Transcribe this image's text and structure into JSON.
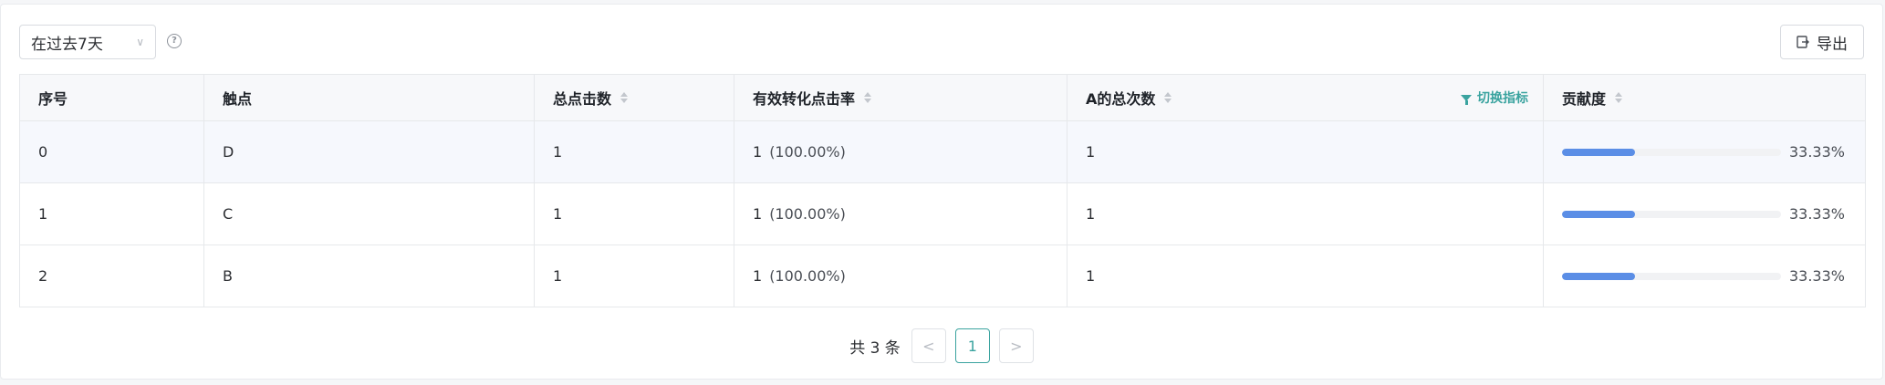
{
  "toolbar": {
    "date_range": "在过去7天",
    "export_label": "导出"
  },
  "table": {
    "headers": {
      "index": "序号",
      "touchpoint": "触点",
      "total_clicks": "总点击数",
      "effective_rate": "有效转化点击率",
      "a_total": "A的总次数",
      "switch_metric": "切换指标",
      "contribution": "贡献度"
    },
    "rows": [
      {
        "index": "0",
        "touchpoint": "D",
        "total_clicks": "1",
        "effective_count": "1",
        "effective_pct": "(100.00%)",
        "a_total": "1",
        "contribution": 0.3333,
        "contribution_label": "33.33%"
      },
      {
        "index": "1",
        "touchpoint": "C",
        "total_clicks": "1",
        "effective_count": "1",
        "effective_pct": "(100.00%)",
        "a_total": "1",
        "contribution": 0.3333,
        "contribution_label": "33.33%"
      },
      {
        "index": "2",
        "touchpoint": "B",
        "total_clicks": "1",
        "effective_count": "1",
        "effective_pct": "(100.00%)",
        "a_total": "1",
        "contribution": 0.3333,
        "contribution_label": "33.33%"
      }
    ]
  },
  "pagination": {
    "total_text": "共 3 条",
    "prev": "<",
    "current_page": "1",
    "next": ">"
  },
  "colors": {
    "accent": "#3aa39f",
    "bar": "#5b8ee6"
  },
  "icons": {
    "date_select": "chevron-down-icon",
    "help": "question-circle-icon",
    "export": "export-icon",
    "switch_metric": "filter-icon",
    "sort": "sort-icon"
  }
}
